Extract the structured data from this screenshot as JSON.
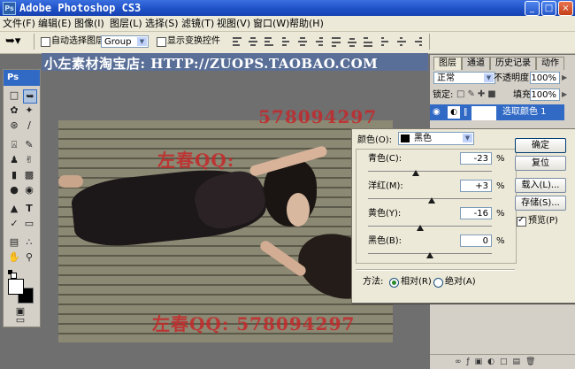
{
  "app": {
    "title": "Adobe Photoshop CS3",
    "ps_badge": "Ps"
  },
  "window_controls": {
    "minimize": "_",
    "maximize": "□",
    "close": "×"
  },
  "menu": [
    "文件(F)",
    "编辑(E)",
    "图像(I)",
    "图层(L)",
    "选择(S)",
    "滤镜(T)",
    "视图(V)",
    "窗口(W)",
    "帮助(H)"
  ],
  "options_bar": {
    "auto_select_label": "自动选择图层",
    "auto_select_value": "Group",
    "show_transform_label": "显示变换控件"
  },
  "toolbox": {
    "header": "Ps"
  },
  "document": {
    "banner": "小左素材淘宝店: HTTP://ZUOPS.TAOBAO.COM",
    "watermark_top_number": "578094297",
    "watermark_mid": "左春QQ:",
    "watermark_bottom": "左春QQ: 578094297"
  },
  "layers_panel": {
    "tabs": [
      "图层",
      "通道",
      "历史记录",
      "动作"
    ],
    "blend_mode": "正常",
    "opacity_label": "不透明度:",
    "opacity_value": "100%",
    "lock_label": "锁定:",
    "fill_label": "填充:",
    "fill_value": "100%",
    "layer_name": "选取颜色 1"
  },
  "selective_color": {
    "colors_label": "颜色(O):",
    "colors_value": "黑色",
    "sliders": [
      {
        "label": "青色(C):",
        "value": "-23",
        "unit": "%",
        "position": 0.385
      },
      {
        "label": "洋红(M):",
        "value": "+3",
        "unit": "%",
        "position": 0.515
      },
      {
        "label": "黄色(Y):",
        "value": "-16",
        "unit": "%",
        "position": 0.42
      },
      {
        "label": "黑色(B):",
        "value": "0",
        "unit": "%",
        "position": 0.5
      }
    ],
    "buttons": {
      "ok": "确定",
      "reset": "复位",
      "load": "载入(L)...",
      "save": "存储(S)..."
    },
    "preview_label": "预览(P)",
    "method_label": "方法:",
    "relative_label": "相对(R)",
    "absolute_label": "绝对(A)"
  },
  "colors": {
    "title_blue": "#1d4fc4",
    "selection_blue": "#316ac5",
    "watermark_red": "#c4282a",
    "panel_gray": "#d4d0c8"
  }
}
